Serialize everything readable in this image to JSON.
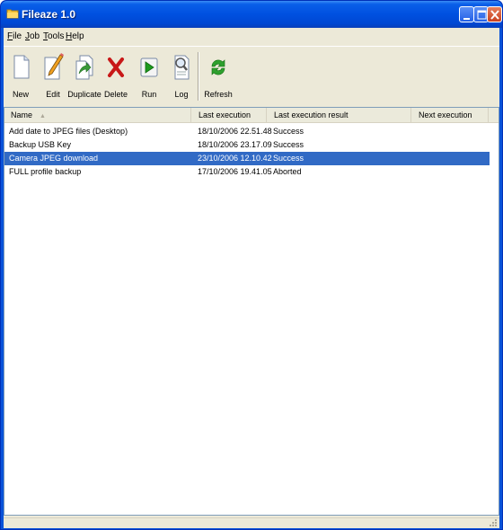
{
  "window": {
    "title": "Fileaze 1.0"
  },
  "menu": [
    "File",
    "Job",
    "Tools",
    "Help"
  ],
  "toolbar": [
    {
      "label": "New",
      "icon": "new-document-icon"
    },
    {
      "label": "Edit",
      "icon": "edit-pencil-icon"
    },
    {
      "label": "Duplicate",
      "icon": "duplicate-icon"
    },
    {
      "label": "Delete",
      "icon": "delete-x-icon"
    },
    {
      "label": "Run",
      "icon": "run-play-icon"
    },
    {
      "label": "Log",
      "icon": "log-magnifier-icon"
    },
    {
      "label": "Refresh",
      "icon": "refresh-icon"
    }
  ],
  "columns": [
    "Name",
    "Last execution",
    "Last execution result",
    "Next execution"
  ],
  "rows": [
    {
      "name": "Add date to JPEG files (Desktop)",
      "last_execution": "18/10/2006 22.51.48",
      "result": "Success",
      "next": ""
    },
    {
      "name": "Backup USB Key",
      "last_execution": "18/10/2006 23.17.09",
      "result": "Success",
      "next": ""
    },
    {
      "name": "Camera JPEG download",
      "last_execution": "23/10/2006 12.10.42",
      "result": "Success",
      "next": "",
      "selected": true
    },
    {
      "name": "FULL profile backup",
      "last_execution": "17/10/2006 19.41.05",
      "result": "Aborted",
      "next": ""
    }
  ],
  "colors": {
    "title_bar": "#0050e0",
    "selection": "#316ac5",
    "face": "#ece9d8"
  }
}
